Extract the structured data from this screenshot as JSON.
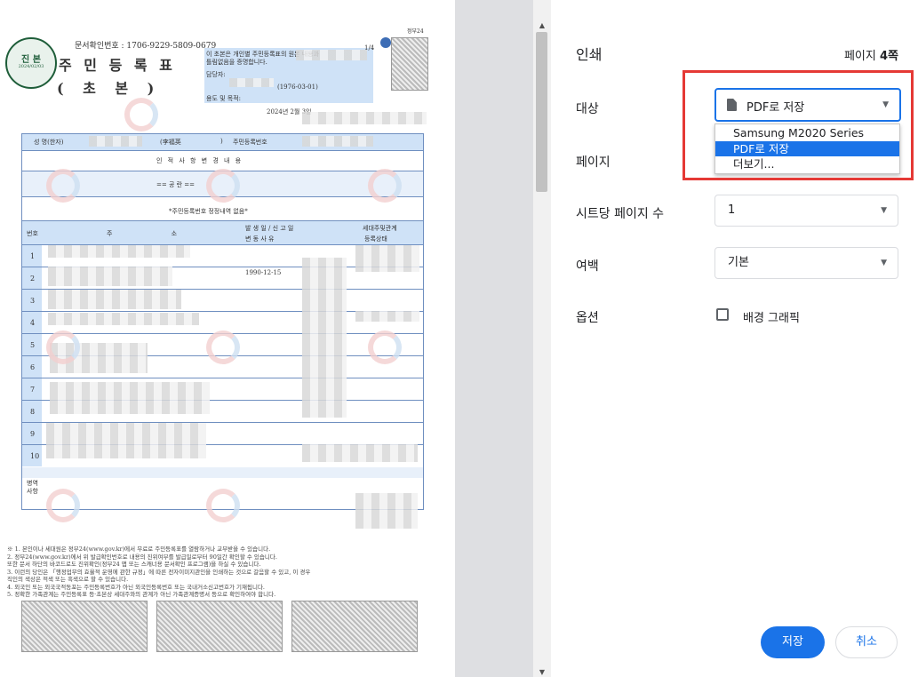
{
  "document": {
    "doc_no_line": "문서확인번호 : 1706-9229-5809-0679",
    "page_frac": "1/4",
    "seal_text": "진 본",
    "seal_date": "2024/02/03",
    "title_line1": "주 민 등 록 표",
    "title_line2": "( 초 본 )",
    "cert_text_1": "이 초본은 개인별 주민등록표의 원본 내용과",
    "cert_text_2": "틀림없음을 증명합니다.",
    "handler_label": "담당자:",
    "birth_date": "(1976-03-01)",
    "purpose_label": "용도 및 목적:",
    "issue_date": "2024년 2월 3일",
    "name_label": "성 명(한자)",
    "name_hanja": "(李福英",
    "rrn_label": "주민등록번호",
    "personal_change_title": "인 적 사 항 변 경 내 용",
    "blank_marker": "== 공 란 ==",
    "rrn_change_note": "*주민등록번호 정정내역 없음*",
    "col_number": "번호",
    "col_address": "주 소",
    "col_date_1": "발 생 일 / 신 고 일",
    "col_date_2": "변 동 사 유",
    "col_household_1": "세대주및관계",
    "col_household_2": "등록상태",
    "row_numbers": [
      "1",
      "2",
      "3",
      "4",
      "5",
      "6",
      "7",
      "8",
      "9",
      "10"
    ],
    "row2_date": "1990-12-15",
    "military_label": "병역사항",
    "footnotes": [
      "※ 1. 본인이나 세대원은 정부24(www.gov.kr)에서 무료로 주민등록표를 열람하거나 교부받을 수 있습니다.",
      "   2. 정부24(www.gov.kr)에서 위 발급확인번호로 내용의 진위여부를 발급일로부터 90일간 확인할 수 있습니다.",
      "      또한 문서 하단의 바코드로도 진위확인(정부24 앱 또는 스캐너용 문서확인 프로그램)을 하실 수 있습니다.",
      "   3. 이런의 당인은 「행정업무의 효율적 운영에 관한 규정」에 따른 전자이미지관인을 인쇄하는 것으로 갈음할 수 있고, 이 경우",
      "      직인의 색상은 적색 또는 흑색으로 할 수 있습니다.",
      "   4. 외국인 또는 외국국적동포는 주민등록번호가 아닌 외국인등록번호 또는 국내거소신고번호가 기재됩니다.",
      "   5. 정확한 가족관계는 주민등록표 등·초본상 세대주와의 관계가 아닌 가족관계증명서 등으로 확인하여야 합니다."
    ],
    "gov24_label": "정부24"
  },
  "panel": {
    "title": "인쇄",
    "page_count": "페이지 ",
    "page_count_num": "4쪽",
    "destination_label": "대상",
    "destination_value": "PDF로 저장",
    "dropdown_options": [
      "Samsung M2020 Series",
      "PDF로 저장",
      "더보기..."
    ],
    "pages_label": "페이지",
    "pages_per_sheet_label": "시트당 페이지 수",
    "pages_per_sheet_value": "1",
    "margins_label": "여백",
    "margins_value": "기본",
    "options_label": "옵션",
    "background_graphics_label": "배경 그래픽",
    "save_button": "저장",
    "cancel_button": "취소"
  },
  "colors": {
    "accent": "#1a73e8",
    "highlight": "#1a73e8",
    "annotation_box": "#e53935",
    "doc_blue": "#cfe2f7"
  }
}
